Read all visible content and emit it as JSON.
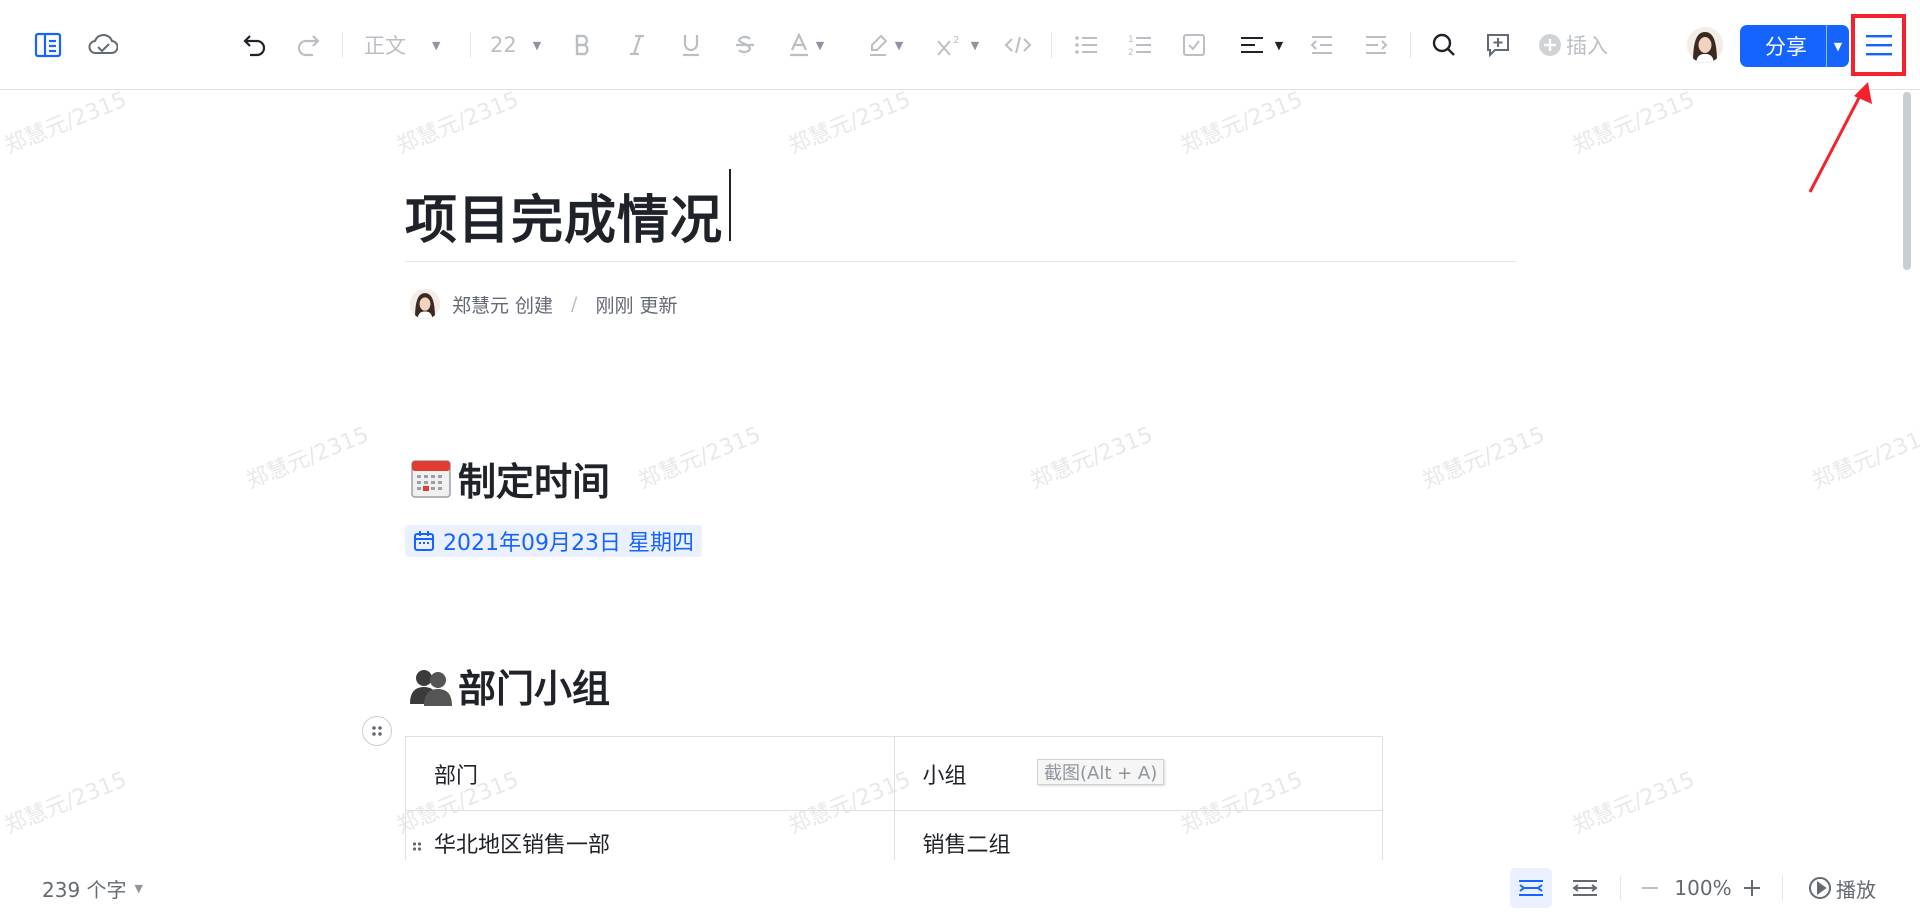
{
  "toolbar": {
    "icons": {
      "outline": "outline-sidebar-icon",
      "cloud": "cloud-saved-icon",
      "undo": "undo-icon",
      "redo": "redo-icon",
      "bold": "bold-icon",
      "italic": "italic-icon",
      "underline": "underline-icon",
      "strikethrough": "strikethrough-icon",
      "font_color": "font-color-icon",
      "highlight": "highlight-icon",
      "superscript": "superscript-icon",
      "code": "inline-code-icon",
      "bullet_list": "bullet-list-icon",
      "numbered_list": "numbered-list-icon",
      "task_list": "task-list-icon",
      "align": "align-left-icon",
      "outdent": "outdent-icon",
      "indent": "indent-icon",
      "search": "search-icon",
      "comment": "add-comment-icon",
      "insert": "plus-circle-icon",
      "menu": "hamburger-menu-icon"
    },
    "paragraph_style": "正文",
    "font_size": "22",
    "insert_label": "插入",
    "share_label": "分享"
  },
  "document": {
    "title": "项目完成情况",
    "author": "郑慧元 创建",
    "updated": "刚刚 更新",
    "section1": {
      "emoji": "calendar-emoji",
      "heading": "制定时间",
      "date": "2021年09月23日 星期四"
    },
    "section2": {
      "emoji": "busts-emoji",
      "heading": "部门小组",
      "table": {
        "header": [
          "部门",
          "小组"
        ],
        "rows": [
          [
            "华北地区销售一部",
            "销售二组"
          ]
        ]
      }
    },
    "tooltip": "截图(Alt + A)"
  },
  "watermark": "郑慧元/2315",
  "statusbar": {
    "word_count": "239 个字",
    "zoom": "100%",
    "play_label": "播放"
  },
  "colors": {
    "accent": "#1664ff",
    "highlight_box": "#f5222d",
    "text": "#1f2329",
    "muted": "#646a73"
  }
}
